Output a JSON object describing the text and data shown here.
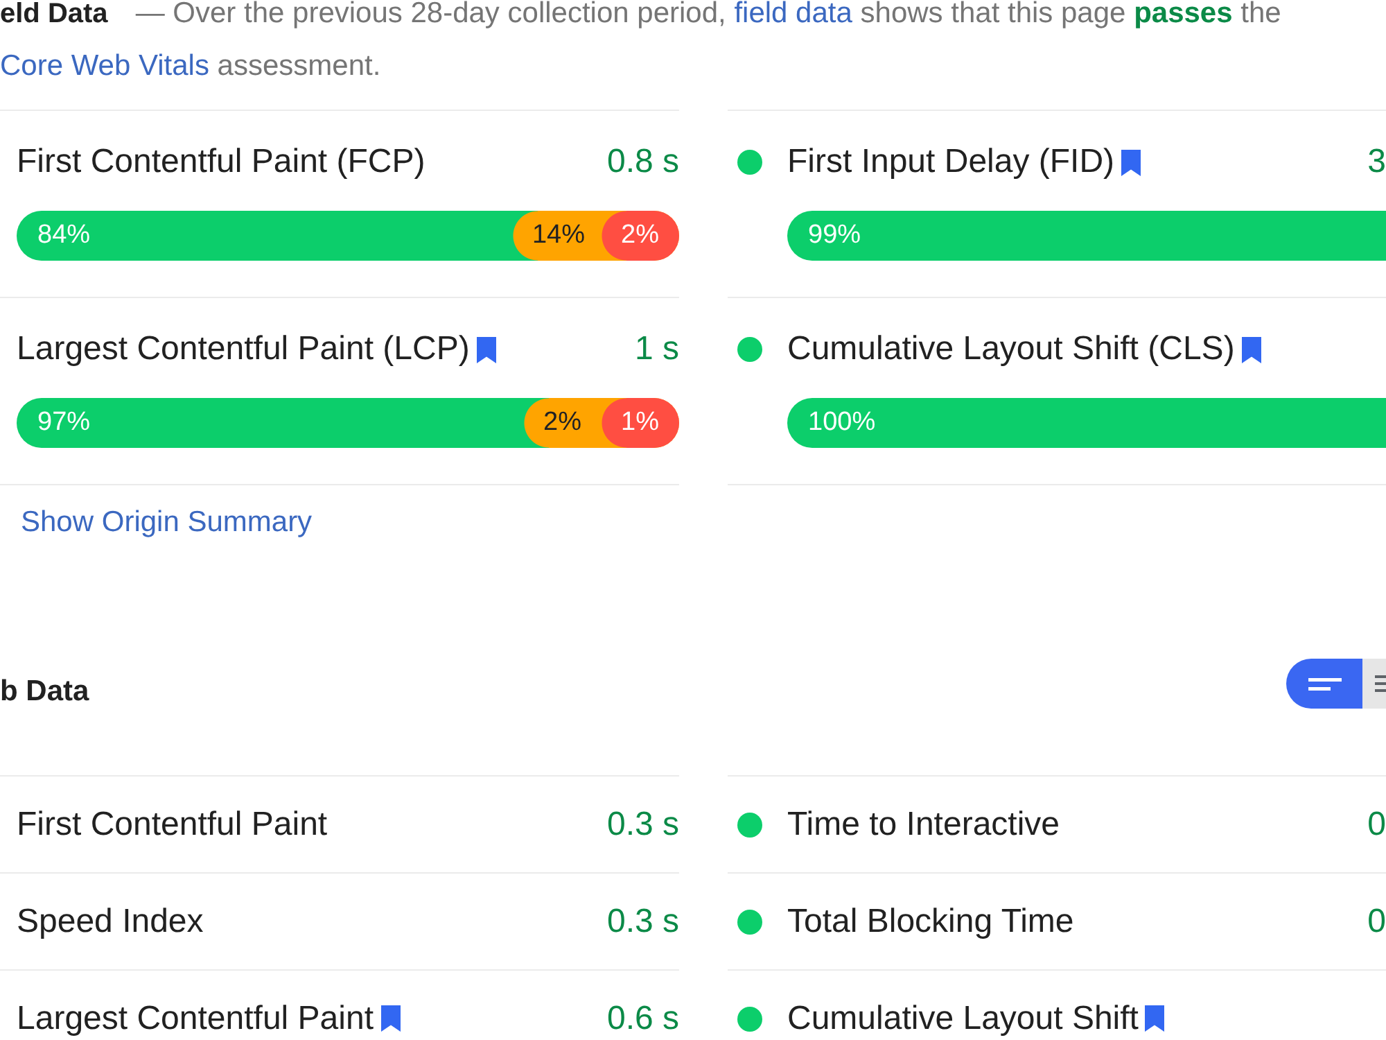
{
  "field_data": {
    "title": "eld Data",
    "description": [
      {
        "kind": "text",
        "text": "— Over the previous 28-day collection period, "
      },
      {
        "kind": "link",
        "text": "field data"
      },
      {
        "kind": "text",
        "text": " shows that this page "
      },
      {
        "kind": "pass",
        "text": "passes"
      },
      {
        "kind": "text",
        "text": " the "
      },
      {
        "kind": "link",
        "text": "Core Web Vitals"
      },
      {
        "kind": "text",
        "text": " assessment."
      }
    ],
    "columns": [
      {
        "metrics": [
          {
            "name": "First Contentful Paint (FCP)",
            "bookmarked": false,
            "value": "0.8 s",
            "distribution": [
              {
                "label": "84%",
                "color": "#0cce6b"
              },
              {
                "label": "14%",
                "color": "#ffa400"
              },
              {
                "label": "2%",
                "color": "#ff4e42"
              }
            ]
          },
          {
            "name": "Largest Contentful Paint (LCP)",
            "bookmarked": true,
            "value": "1 s",
            "distribution": [
              {
                "label": "97%",
                "color": "#0cce6b"
              },
              {
                "label": "2%",
                "color": "#ffa400"
              },
              {
                "label": "1%",
                "color": "#ff4e42"
              }
            ]
          }
        ]
      },
      {
        "metrics": [
          {
            "name": "First Input Delay (FID)",
            "color": "#0cce6b",
            "bookmarked": true,
            "value": "3",
            "distribution": [
              {
                "label": "99%",
                "color": "#0cce6b"
              }
            ]
          },
          {
            "name": "Cumulative Layout Shift (CLS)",
            "color": "#0cce6b",
            "bookmarked": true,
            "distribution": [
              {
                "label": "100%",
                "color": "#0cce6b"
              }
            ]
          }
        ]
      }
    ],
    "origin_summary_link": "Show Origin Summary"
  },
  "lab_data": {
    "title": "b Data",
    "view_toggle": [
      {
        "kind": "summary",
        "selected": true
      },
      {
        "kind": "list",
        "selected": false
      }
    ],
    "columns": [
      {
        "metrics": [
          {
            "name": "First Contentful Paint",
            "bookmarked": false,
            "value": "0.3 s"
          },
          {
            "name": "Speed Index",
            "bookmarked": false,
            "value": "0.3 s"
          },
          {
            "name": "Largest Contentful Paint",
            "bookmarked": true,
            "value": "0.6 s"
          }
        ]
      },
      {
        "metrics": [
          {
            "name": "Time to Interactive",
            "color": "#0cce6b",
            "bookmarked": false,
            "value": "0"
          },
          {
            "name": "Total Blocking Time",
            "color": "#0cce6b",
            "bookmarked": false,
            "value": "0"
          },
          {
            "name": "Cumulative Layout Shift",
            "color": "#0cce6b",
            "bookmarked": true
          }
        ]
      }
    ]
  }
}
